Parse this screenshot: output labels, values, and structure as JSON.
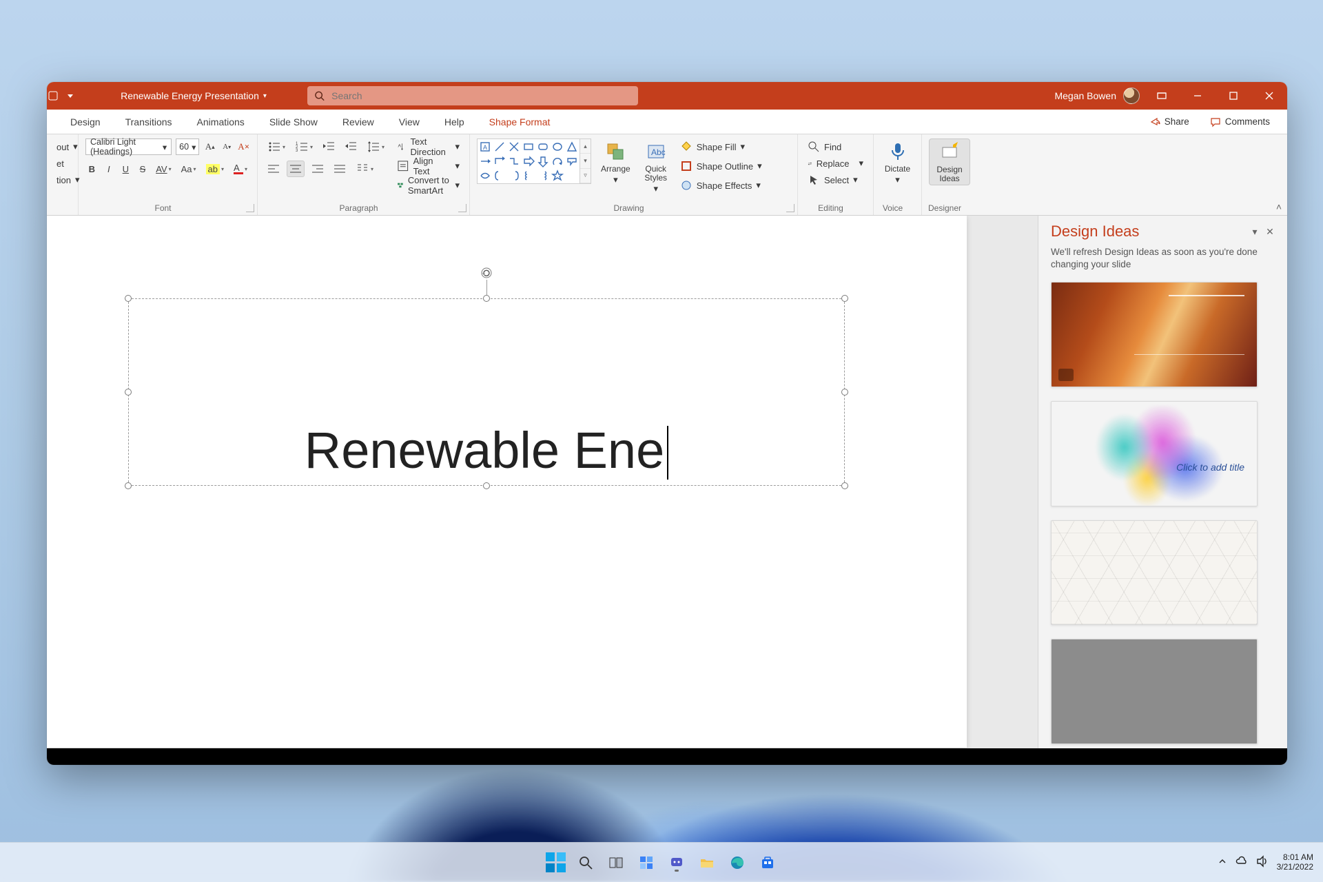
{
  "window": {
    "doc_title": "Renewable Energy Presentation",
    "search_placeholder": "Search",
    "user_name": "Megan Bowen"
  },
  "tabs": {
    "design": "Design",
    "transitions": "Transitions",
    "animations": "Animations",
    "slide_show": "Slide Show",
    "review": "Review",
    "view": "View",
    "help": "Help",
    "shape_format": "Shape Format",
    "share": "Share",
    "comments": "Comments"
  },
  "ribbon": {
    "left": {
      "out": "out",
      "et": "et",
      "tion": "tion"
    },
    "font": {
      "group": "Font",
      "name": "Calibri Light (Headings)",
      "size": "60",
      "bold": "B",
      "italic": "I",
      "underline": "U",
      "strike": "S",
      "spacing": "AV",
      "case": "Aa",
      "clear": "A"
    },
    "paragraph": {
      "group": "Paragraph",
      "text_direction": "Text Direction",
      "align_text": "Align Text",
      "convert_smartart": "Convert to SmartArt"
    },
    "drawing": {
      "group": "Drawing",
      "arrange": "Arrange",
      "quick_styles_1": "Quick",
      "quick_styles_2": "Styles",
      "shape_fill": "Shape Fill",
      "shape_outline": "Shape Outline",
      "shape_effects": "Shape Effects"
    },
    "editing": {
      "group": "Editing",
      "find": "Find",
      "replace": "Replace",
      "select": "Select"
    },
    "voice": {
      "group": "Voice",
      "dictate": "Dictate"
    },
    "designer": {
      "group": "Designer",
      "design_ideas_1": "Design",
      "design_ideas_2": "Ideas"
    }
  },
  "slide": {
    "title_text": "Renewable Ene"
  },
  "pane": {
    "title": "Design Ideas",
    "subtitle": "We'll refresh Design Ideas as soon as you're done changing your slide",
    "idea2_caption": "Click to add title"
  },
  "system": {
    "time": "8:01 AM",
    "date": "3/21/2022"
  }
}
